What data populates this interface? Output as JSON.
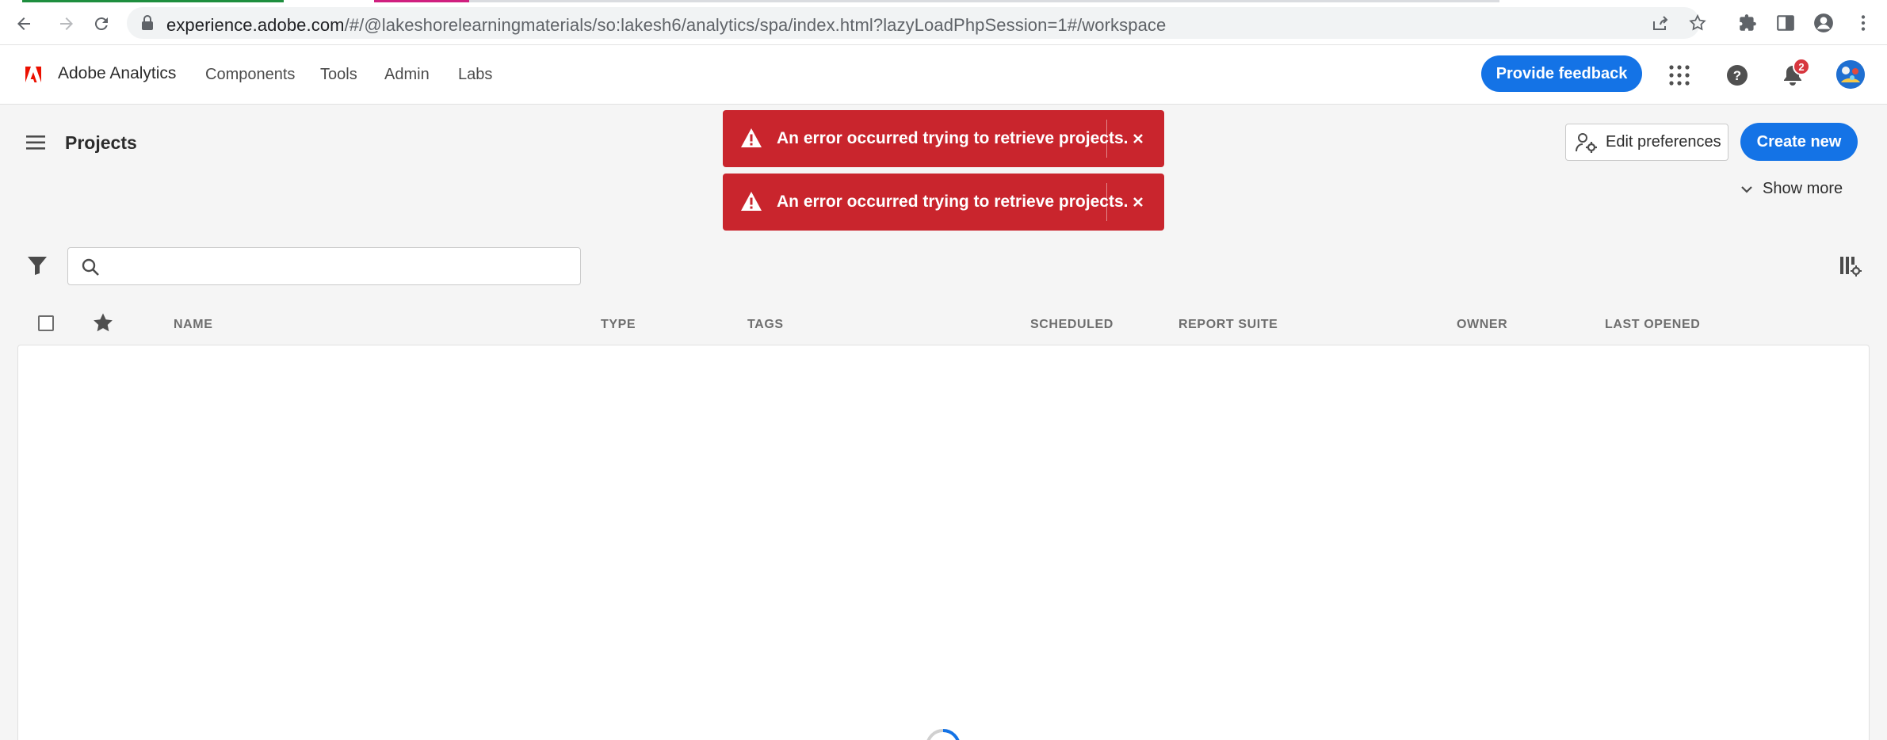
{
  "browser": {
    "url_host": "experience.adobe.com",
    "url_path": "/#/@lakeshorelearningmaterials/so:lakesh6/analytics/spa/index.html?lazyLoadPhpSession=1#/workspace"
  },
  "app": {
    "name": "Adobe Analytics",
    "nav": [
      "Components",
      "Tools",
      "Admin",
      "Labs"
    ],
    "feedback_label": "Provide feedback",
    "notification_count": "2"
  },
  "page": {
    "title": "Projects",
    "edit_preferences_label": "Edit preferences",
    "create_new_label": "Create new",
    "show_more_label": "Show more"
  },
  "toasts": [
    {
      "message": "An error occurred trying to retrieve projects."
    },
    {
      "message": "An error occurred trying to retrieve projects."
    }
  ],
  "search": {
    "value": "",
    "placeholder": ""
  },
  "table": {
    "columns": [
      "NAME",
      "TYPE",
      "TAGS",
      "SCHEDULED",
      "REPORT SUITE",
      "OWNER",
      "LAST OPENED"
    ]
  },
  "colors": {
    "accent": "#1473e6",
    "error": "#c9252d",
    "brand": "#eb1000"
  },
  "icons": [
    "back-icon",
    "forward-icon",
    "reload-icon",
    "lock-icon",
    "share-icon",
    "star-icon",
    "extensions-icon",
    "sidepanel-icon",
    "profile-icon",
    "kebab-icon",
    "adobe-logo",
    "app-switcher-icon",
    "help-icon",
    "bell-icon",
    "hamburger-icon",
    "user-gear-icon",
    "chevron-down-icon",
    "alert-icon",
    "close-icon",
    "filter-icon",
    "search-icon",
    "column-settings-icon",
    "spinner-icon"
  ]
}
